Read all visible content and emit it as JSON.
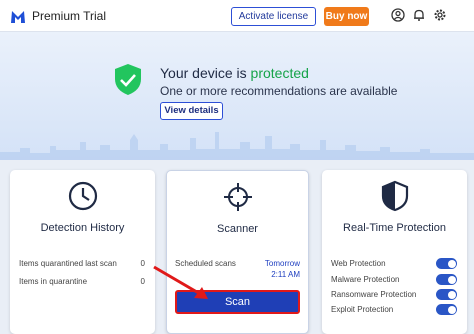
{
  "app": {
    "title": "Premium Trial",
    "logo_icon": "malwarebytes-logo-icon"
  },
  "toolbar": {
    "activate_label": "Activate license",
    "buy_label": "Buy now",
    "icons": [
      "account-icon",
      "bell-icon",
      "gear-icon"
    ],
    "buy_color": "#f07a1a",
    "accent_color": "#2d4fd6"
  },
  "hero": {
    "status_prefix": "Your device is ",
    "status_value": "protected",
    "status_color": "#16a34a",
    "subtitle": "One or more recommendations are available",
    "details_label": "View details"
  },
  "cards": {
    "history": {
      "title": "Detection History",
      "rows": [
        {
          "label": "Items quarantined last scan",
          "value": "0"
        },
        {
          "label": "Items in quarantine",
          "value": "0"
        }
      ]
    },
    "scanner": {
      "title": "Scanner",
      "scheduled_label": "Scheduled scans",
      "scheduled_day": "Tomorrow",
      "scheduled_time": "2:11 AM",
      "scan_label": "Scan"
    },
    "realtime": {
      "title": "Real-Time Protection",
      "items": [
        {
          "label": "Web Protection",
          "on": true
        },
        {
          "label": "Malware Protection",
          "on": true
        },
        {
          "label": "Ransomware Protection",
          "on": true
        },
        {
          "label": "Exploit Protection",
          "on": true
        }
      ]
    }
  }
}
